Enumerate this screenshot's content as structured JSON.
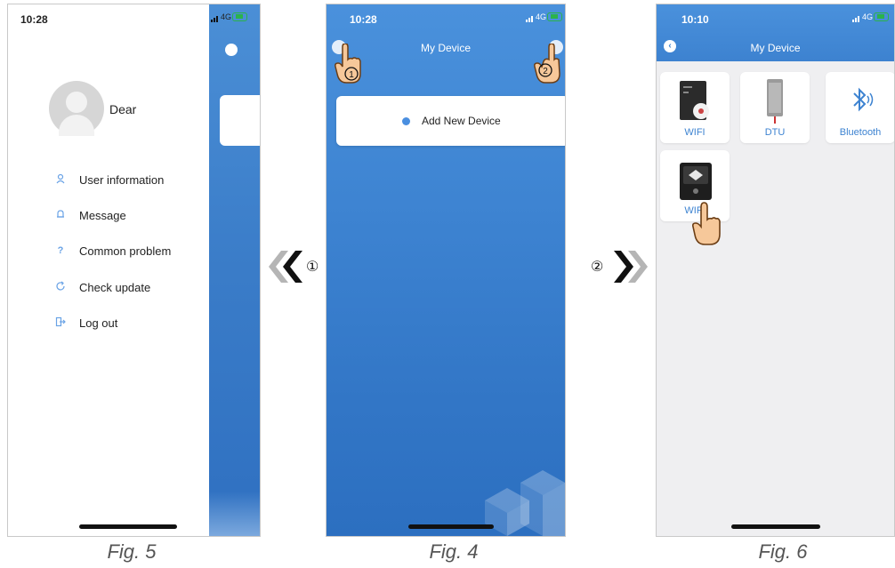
{
  "fig5": {
    "caption": "Fig. 5",
    "status_time": "10:28",
    "status_network": "4G",
    "user_name": "Dear",
    "menu": [
      {
        "label": "User information",
        "icon": "user-icon"
      },
      {
        "label": "Message",
        "icon": "bell-icon"
      },
      {
        "label": "Common problem",
        "icon": "question-icon"
      },
      {
        "label": "Check update",
        "icon": "refresh-icon"
      },
      {
        "label": "Log out",
        "icon": "logout-icon"
      }
    ]
  },
  "fig4": {
    "caption": "Fig. 4",
    "status_time": "10:28",
    "status_network": "4G",
    "title": "My Device",
    "add_device_label": "Add New Device",
    "step_left": "①",
    "step_right": "②"
  },
  "fig6": {
    "caption": "Fig. 6",
    "status_time": "10:10",
    "status_network": "4G",
    "title": "My Device",
    "tiles": [
      {
        "label": "WIFI",
        "icon": "wifi-inverter-icon"
      },
      {
        "label": "DTU",
        "icon": "dtu-device-icon"
      },
      {
        "label": "Bluetooth",
        "icon": "bluetooth-icon"
      },
      {
        "label": "WIFI",
        "icon": "wifi-stick-icon"
      }
    ]
  },
  "arrows": {
    "left_step": "①",
    "right_step": "②"
  },
  "colors": {
    "blue_top": "#4a91dc",
    "blue_bottom": "#2c6fc0",
    "accent_text": "#3d83d1",
    "icon_light_blue": "#6aa3e6",
    "arrow_dark": "#111111",
    "arrow_gray": "#b5b5b5"
  }
}
